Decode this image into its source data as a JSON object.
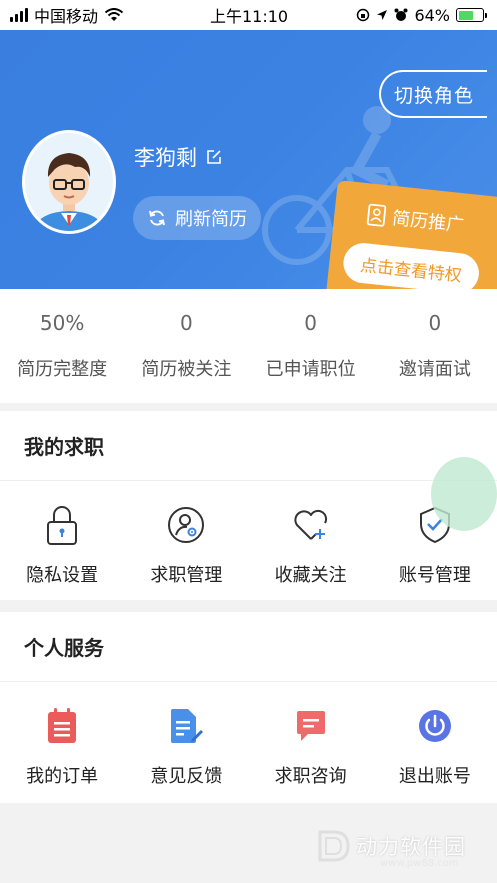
{
  "status_bar": {
    "carrier": "中国移动",
    "time": "上午11:10",
    "battery": "64%",
    "battery_level": 0.64
  },
  "header": {
    "switch_role": "切换角色",
    "username": "李狗剩",
    "refresh_resume": "刷新简历",
    "promo_title": "简历推广",
    "promo_button": "点击查看特权",
    "accent_color": "#3a7fe0",
    "promo_color": "#f2a73b"
  },
  "stats": [
    {
      "value": "50%",
      "label": "简历完整度"
    },
    {
      "value": "0",
      "label": "简历被关注"
    },
    {
      "value": "0",
      "label": "已申请职位"
    },
    {
      "value": "0",
      "label": "邀请面试"
    }
  ],
  "job_section": {
    "title": "我的求职",
    "items": [
      {
        "label": "隐私设置",
        "icon": "lock-icon"
      },
      {
        "label": "求职管理",
        "icon": "user-settings-icon"
      },
      {
        "label": "收藏关注",
        "icon": "heart-plus-icon"
      },
      {
        "label": "账号管理",
        "icon": "shield-check-icon"
      }
    ]
  },
  "service_section": {
    "title": "个人服务",
    "items": [
      {
        "label": "我的订单",
        "icon": "order-clipboard-icon"
      },
      {
        "label": "意见反馈",
        "icon": "feedback-document-icon"
      },
      {
        "label": "求职咨询",
        "icon": "chat-bubble-icon"
      },
      {
        "label": "退出账号",
        "icon": "power-icon"
      }
    ]
  },
  "watermark": {
    "text": "动力软件园",
    "url": "www.pw88.com"
  }
}
